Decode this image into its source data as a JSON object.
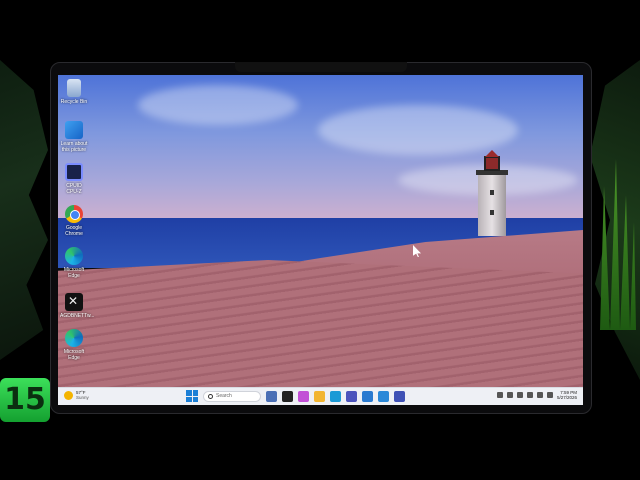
{
  "desktop": {
    "icons": [
      {
        "label": "Recycle Bin",
        "icon": "recycle-bin-icon"
      },
      {
        "label": "Learn about this picture",
        "icon": "photo-info-icon"
      },
      {
        "label": "CPUID CPU-Z",
        "icon": "cpu-z-icon"
      },
      {
        "label": "Google Chrome",
        "icon": "chrome-icon"
      },
      {
        "label": "Microsoft Edge",
        "icon": "edge-icon"
      },
      {
        "label": "AGDBNETTw...",
        "icon": "app-icon"
      },
      {
        "label": "Microsoft Edge",
        "icon": "edge-icon"
      }
    ]
  },
  "taskbar": {
    "weather": {
      "temp": "57°F",
      "condition": "Sunny"
    },
    "search_placeholder": "Search",
    "apps": [
      {
        "icon": "gallery-icon",
        "color": "#4a6fb5"
      },
      {
        "icon": "widget-icon",
        "color": "#222222"
      },
      {
        "icon": "copilot-icon",
        "color": "#c24fd6"
      },
      {
        "icon": "file-explorer-icon",
        "color": "#f2b531"
      },
      {
        "icon": "edge-icon",
        "color": "#1b9ad6"
      },
      {
        "icon": "teams-icon",
        "color": "#4b53bc"
      },
      {
        "icon": "edge-beta-icon",
        "color": "#2a7ad0"
      },
      {
        "icon": "store-icon",
        "color": "#2b88d8"
      },
      {
        "icon": "app-icon",
        "color": "#3f51b5"
      }
    ],
    "clock": {
      "time": "7:59 PM",
      "date": "5/27/2026"
    }
  },
  "brand": {
    "logo_text": "15"
  }
}
